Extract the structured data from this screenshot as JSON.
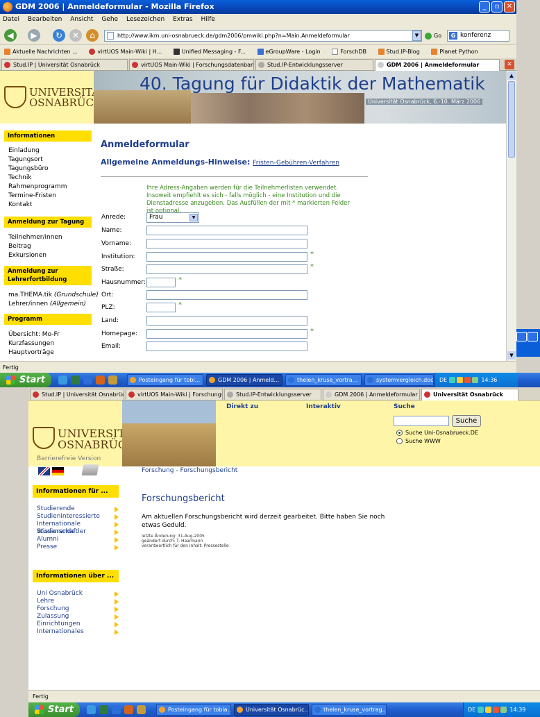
{
  "windowA": {
    "title": "GDM 2006 | Anmeldeformular - Mozilla Firefox",
    "menu": [
      "Datei",
      "Bearbeiten",
      "Ansicht",
      "Gehe",
      "Lesezeichen",
      "Extras",
      "Hilfe"
    ],
    "url": "http://www.ikm.uni-osnabrueck.de/gdm2006/pmwiki.php?n=Main.Anmeldeformular",
    "go_label": "Go",
    "search_value": "konferenz",
    "bookmarks": [
      "Aktuelle Nachrichten ...",
      "virtUOS Main-Wiki | H...",
      "Unified Messaging - F...",
      "eGroupWare - Login",
      "ForschDB",
      "Stud.IP-Blog",
      "Planet Python"
    ],
    "tabs": [
      "Stud.IP | Universität Osnabrück",
      "virtUOS Main-Wiki | Forschungsdatenbank ...",
      "Stud.IP-Entwicklungsserver",
      "GDM 2006 | Anmeldeformular"
    ],
    "status": "Fertig"
  },
  "pageA": {
    "logo_line1": "UNIVERSITÄT",
    "logo_line2": "OSNABRÜCK",
    "banner_title": "40. Tagung für Didaktik der Mathematik",
    "banner_sub": "Universität Osnabrück, 6.-10. März 2006",
    "sidebar": {
      "sec1": "Informationen",
      "sec1_links": [
        "Einladung",
        "Tagungsort",
        "Tagungsbüro",
        "Technik",
        "Rahmenprogramm",
        "Termine-Fristen",
        "Kontakt"
      ],
      "sec2": "Anmeldung zur Tagung",
      "sec2_links": [
        "Teilnehmer/innen",
        "Beitrag",
        "Exkursionen"
      ],
      "sec3a": "Anmeldung zur",
      "sec3b": "Lehrerfortbildung",
      "sec3_link1_a": "ma.THEMA.tik ",
      "sec3_link1_b": "(Grundschule)",
      "sec3_link2_a": "Lehrer/innen ",
      "sec3_link2_b": "(Allgemein)",
      "sec4": "Programm",
      "sec4_links": [
        "Übersicht: Mo-Fr",
        "Kurzfassungen",
        "Hauptvorträge"
      ]
    },
    "form_title": "Anmeldeformular",
    "form_sub": "Allgemeine Anmeldungs-Hinweise:",
    "form_sub_link": "Fristen-Gebühren-Verfahren",
    "form_note": "Ihre Adress-Angaben werden für die Teilnehmerlisten verwendet. Insoweit empfiehlt es sich - falls möglich - eine Institution und die Dienstadresse anzugeben. Das Ausfüllen der mit * markierten Felder ist optional.",
    "anrede_label": "Anrede:",
    "anrede_value": "Frau",
    "fields": [
      "Name:",
      "Vorname:",
      "Institution:",
      "Straße:",
      "Hausnummer:",
      "Ort:",
      "PLZ:",
      "Land:",
      "Homepage:",
      "Email:"
    ],
    "star": "*"
  },
  "taskbarA": {
    "start": "Start",
    "tasks": [
      "Posteingang für tobi...",
      "GDM 2006 | Anmeld...",
      "thelen_kruse_vortra...",
      "systemvergleich.doc..."
    ],
    "lang": "DE",
    "clock": "14:36"
  },
  "windowB": {
    "tabs": [
      "Stud.IP | Universität Osnabrück",
      "virtUOS Main-Wiki | Forschungsd...",
      "Stud.IP-Entwicklungsserver",
      "GDM 2006 | Anmeldeformular",
      "Universität Osnabrück"
    ],
    "status": "Fertig"
  },
  "pageB": {
    "logo_line1": "UNIVERSITÄT",
    "logo_line2": "OSNABRÜCK",
    "nav_direkt": "Direkt zu",
    "nav_interaktiv": "Interaktiv",
    "nav_suche": "Suche",
    "search_button": "Suche",
    "radio1": "Suche Uni-Osnabrueck.DE",
    "radio2": "Suche WWW",
    "barrierefrei": "Barrierefreie Version",
    "sec1": "Informationen für ...",
    "sec1_links": [
      "Studierende",
      "Studieninteressierte",
      "Internationale Studierende",
      "Wissenschaftler",
      "Alumni",
      "Presse"
    ],
    "sec2": "Informationen über ...",
    "sec2_links": [
      "Uni Osnabrück",
      "Lehre",
      "Forschung",
      "Zulassung",
      "Einrichtungen",
      "Internationales"
    ],
    "breadcrumb": "Forschung - Forschungsbericht",
    "heading": "Forschungsbericht",
    "body": "Am aktuellen Forschungsbericht wird derzeit gearbeitet. Bitte haben Sie noch etwas Geduld.",
    "meta1": "letzte Änderung: 31-Aug-2005",
    "meta2": "geändert durch: T. Haarmann",
    "meta3": "verantwortlich für den Inhalt: Pressestelle"
  },
  "taskbarB": {
    "start": "Start",
    "tasks": [
      "Posteingang für tobia...",
      "Universität Osnabrüc...",
      "thelen_kruse_vortrag..."
    ],
    "lang": "DE",
    "clock": "14:39"
  }
}
